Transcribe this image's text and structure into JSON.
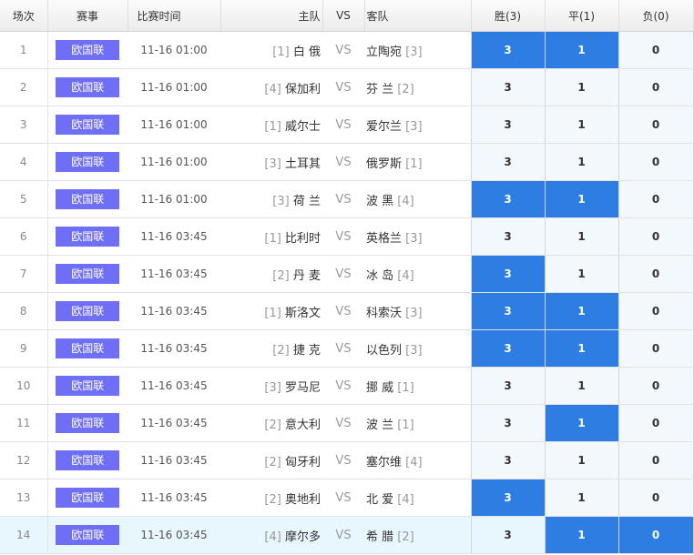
{
  "header": {
    "col_index": "场次",
    "col_league": "赛事",
    "col_time": "比赛时间",
    "col_home": "主队",
    "col_vs": "VS",
    "col_away": "客队",
    "col_win": "胜(3)",
    "col_draw": "平(1)",
    "col_lose": "负(0)"
  },
  "colors": {
    "league_badge": "#6f6ef7",
    "selected": "#2d7de3",
    "row_highlight": "#e8f6fd"
  },
  "vs_label": "VS",
  "matches": [
    {
      "no": "1",
      "league": "欧国联",
      "time": "11-16 01:00",
      "home_rank": "[1]",
      "home": "白 俄",
      "away": "立陶宛",
      "away_rank": "[3]",
      "win": "3",
      "draw": "1",
      "lose": "0",
      "sel_win": true,
      "sel_draw": true,
      "sel_lose": false
    },
    {
      "no": "2",
      "league": "欧国联",
      "time": "11-16 01:00",
      "home_rank": "[4]",
      "home": "保加利",
      "away": "芬 兰",
      "away_rank": "[2]",
      "win": "3",
      "draw": "1",
      "lose": "0",
      "sel_win": false,
      "sel_draw": false,
      "sel_lose": false
    },
    {
      "no": "3",
      "league": "欧国联",
      "time": "11-16 01:00",
      "home_rank": "[1]",
      "home": "威尔士",
      "away": "爱尔兰",
      "away_rank": "[3]",
      "win": "3",
      "draw": "1",
      "lose": "0",
      "sel_win": false,
      "sel_draw": false,
      "sel_lose": false
    },
    {
      "no": "4",
      "league": "欧国联",
      "time": "11-16 01:00",
      "home_rank": "[3]",
      "home": "土耳其",
      "away": "俄罗斯",
      "away_rank": "[1]",
      "win": "3",
      "draw": "1",
      "lose": "0",
      "sel_win": false,
      "sel_draw": false,
      "sel_lose": false
    },
    {
      "no": "5",
      "league": "欧国联",
      "time": "11-16 01:00",
      "home_rank": "[3]",
      "home": "荷 兰",
      "away": "波 黑",
      "away_rank": "[4]",
      "win": "3",
      "draw": "1",
      "lose": "0",
      "sel_win": true,
      "sel_draw": true,
      "sel_lose": false
    },
    {
      "no": "6",
      "league": "欧国联",
      "time": "11-16 03:45",
      "home_rank": "[1]",
      "home": "比利时",
      "away": "英格兰",
      "away_rank": "[3]",
      "win": "3",
      "draw": "1",
      "lose": "0",
      "sel_win": false,
      "sel_draw": false,
      "sel_lose": false
    },
    {
      "no": "7",
      "league": "欧国联",
      "time": "11-16 03:45",
      "home_rank": "[2]",
      "home": "丹 麦",
      "away": "冰 岛",
      "away_rank": "[4]",
      "win": "3",
      "draw": "1",
      "lose": "0",
      "sel_win": true,
      "sel_draw": false,
      "sel_lose": false
    },
    {
      "no": "8",
      "league": "欧国联",
      "time": "11-16 03:45",
      "home_rank": "[1]",
      "home": "斯洛文",
      "away": "科索沃",
      "away_rank": "[3]",
      "win": "3",
      "draw": "1",
      "lose": "0",
      "sel_win": true,
      "sel_draw": true,
      "sel_lose": false
    },
    {
      "no": "9",
      "league": "欧国联",
      "time": "11-16 03:45",
      "home_rank": "[2]",
      "home": "捷 克",
      "away": "以色列",
      "away_rank": "[3]",
      "win": "3",
      "draw": "1",
      "lose": "0",
      "sel_win": true,
      "sel_draw": true,
      "sel_lose": false
    },
    {
      "no": "10",
      "league": "欧国联",
      "time": "11-16 03:45",
      "home_rank": "[3]",
      "home": "罗马尼",
      "away": "挪 威",
      "away_rank": "[1]",
      "win": "3",
      "draw": "1",
      "lose": "0",
      "sel_win": false,
      "sel_draw": false,
      "sel_lose": false
    },
    {
      "no": "11",
      "league": "欧国联",
      "time": "11-16 03:45",
      "home_rank": "[2]",
      "home": "意大利",
      "away": "波 兰",
      "away_rank": "[1]",
      "win": "3",
      "draw": "1",
      "lose": "0",
      "sel_win": false,
      "sel_draw": true,
      "sel_lose": false
    },
    {
      "no": "12",
      "league": "欧国联",
      "time": "11-16 03:45",
      "home_rank": "[2]",
      "home": "匈牙利",
      "away": "塞尔维",
      "away_rank": "[4]",
      "win": "3",
      "draw": "1",
      "lose": "0",
      "sel_win": false,
      "sel_draw": false,
      "sel_lose": false
    },
    {
      "no": "13",
      "league": "欧国联",
      "time": "11-16 03:45",
      "home_rank": "[2]",
      "home": "奥地利",
      "away": "北 爱",
      "away_rank": "[4]",
      "win": "3",
      "draw": "1",
      "lose": "0",
      "sel_win": true,
      "sel_draw": false,
      "sel_lose": false
    },
    {
      "no": "14",
      "league": "欧国联",
      "time": "11-16 03:45",
      "home_rank": "[4]",
      "home": "摩尔多",
      "away": "希 腊",
      "away_rank": "[2]",
      "win": "3",
      "draw": "1",
      "lose": "0",
      "sel_win": false,
      "sel_draw": true,
      "sel_lose": true,
      "highlight": true
    }
  ]
}
